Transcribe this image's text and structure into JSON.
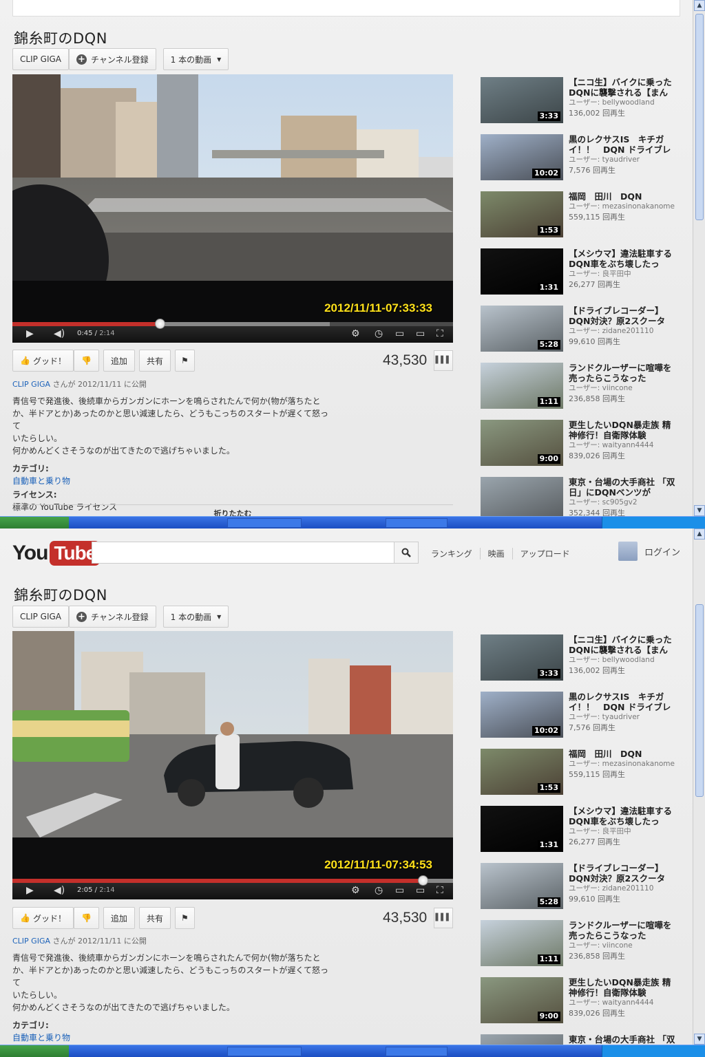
{
  "header": {
    "logo_you": "You",
    "logo_tube": "Tube",
    "search_placeholder": "",
    "nav": [
      "ランキング",
      "映画",
      "アップロード"
    ],
    "login": "ログイン"
  },
  "video": {
    "title": "錦糸町のDQN",
    "channel_name": "CLIP GIGA",
    "subscribe_label": "チャンネル登録",
    "videos_count_label": "1 本の動画",
    "views": "43,530",
    "like_label": "グッド！",
    "add_label": "追加",
    "share_label": "共有",
    "duration": "2:14"
  },
  "frames": [
    {
      "current_time": "0:45",
      "timestamp": "2012/11/11-07:33:33",
      "progress_fraction": 0.336,
      "buffered_fraction": 0.72
    },
    {
      "current_time": "2:05",
      "timestamp": "2012/11/11-07:34:53",
      "progress_fraction": 0.933,
      "buffered_fraction": 1.0
    }
  ],
  "description": {
    "channel": "CLIP GIGA",
    "published": "さんが 2012/11/11 に公開",
    "lines": [
      "青信号で発進後、後続車からガンガンにホーンを鳴らされたんで何か(物が落ちたと",
      "か、半ドアとか)あったのかと思い減速したら、どうもこっちのスタートが遅くて怒って",
      "いたらしい。",
      "何かめんどくさそうなのが出てきたので逃げちゃいました。"
    ],
    "category_label": "カテゴリ:",
    "category_value": "自動車と乗り物",
    "license_label": "ライセンス:",
    "license_value": "標準の YouTube ライセンス",
    "fold_label": "折りたたむ"
  },
  "related": [
    {
      "title": "【ニコ生】バイクに乗った DQNに襲撃される【まん",
      "user": "bellywoodland",
      "views": "136,002 回再生",
      "duration": "3:33",
      "colors": [
        "#6f7f86",
        "#3c4548"
      ]
    },
    {
      "title": "黒のレクサスIS　キチガイ！！　DQN ドライブレ",
      "user": "tyaudriver",
      "views": "7,576 回再生",
      "duration": "10:02",
      "colors": [
        "#9fb0c8",
        "#4a4f57"
      ]
    },
    {
      "title": "福岡　田川　DQN",
      "user": "mezasinonakanome",
      "views": "559,115 回再生",
      "duration": "1:53",
      "colors": [
        "#7d8a6a",
        "#4b4034"
      ]
    },
    {
      "title": "【メシウマ】違法駐車する DQN車をぶち壊したっ",
      "user": "良平田中",
      "views": "26,277 回再生",
      "duration": "1:31",
      "colors": [
        "#111111",
        "#000000"
      ]
    },
    {
      "title": "【ドライブレコーダー】 DQN対決？原2スクータ",
      "user": "zidane201110",
      "views": "99,610 回再生",
      "duration": "5:28",
      "colors": [
        "#b9c3cc",
        "#5b6266"
      ]
    },
    {
      "title": "ランドクルーザーに喧嘩を売ったらこうなった",
      "user": "viincone",
      "views": "236,858 回再生",
      "duration": "1:11",
      "colors": [
        "#c6d1dc",
        "#6d7865"
      ]
    },
    {
      "title": "更生したいDQN暴走族 精神修行！自衛隊体験",
      "user": "waityann4444",
      "views": "839,026 回再生",
      "duration": "9:00",
      "colors": [
        "#8a9880",
        "#55503f"
      ]
    },
    {
      "title": "東京・台場の大手商社 「双日」にDQNベンツが",
      "user": "sc905gv2",
      "views": "352,344 回再生",
      "duration": "",
      "colors": [
        "#9aa5ad",
        "#55595c"
      ]
    }
  ],
  "user_prefix": "ユーザー: "
}
